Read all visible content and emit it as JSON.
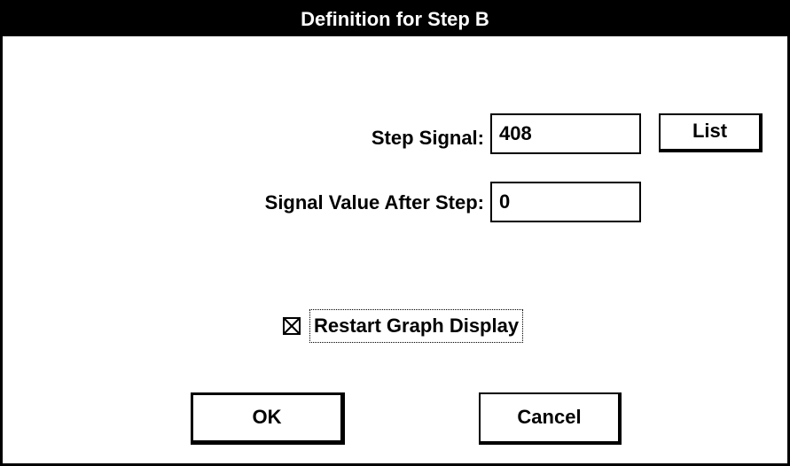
{
  "dialog": {
    "title": "Definition for Step B"
  },
  "step_signal": {
    "label": "Step Signal:",
    "value": "408"
  },
  "list_button": {
    "label": "List"
  },
  "signal_value_after_step": {
    "label": "Signal Value After Step:",
    "value": "0"
  },
  "restart_graph_display": {
    "label": "Restart Graph Display",
    "checked": true,
    "icon": "checkbox-checked-icon"
  },
  "buttons": {
    "ok_label": "OK",
    "cancel_label": "Cancel"
  }
}
